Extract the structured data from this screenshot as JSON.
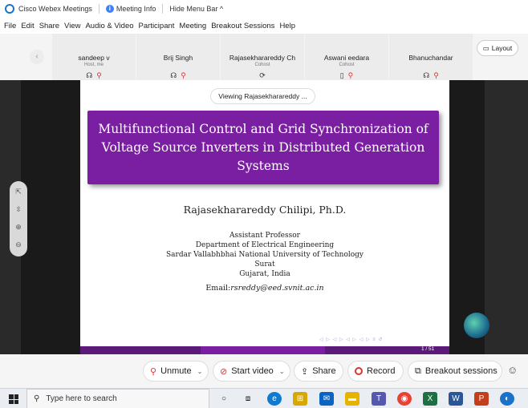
{
  "titlebar": {
    "app_title": "Cisco Webex Meetings",
    "meeting_info": "Meeting Info",
    "hide_menu": "Hide Menu Bar ^"
  },
  "menu": [
    "File",
    "Edit",
    "Share",
    "View",
    "Audio & Video",
    "Participant",
    "Meeting",
    "Breakout Sessions",
    "Help"
  ],
  "participants": [
    {
      "name": "sandeep v",
      "role": "Host, me"
    },
    {
      "name": "Brij Singh",
      "role": ""
    },
    {
      "name": "Rajasekharareddy Ch",
      "role": "Cohost"
    },
    {
      "name": "Aswani eedara",
      "role": "Cohost"
    },
    {
      "name": "Bhanuchandar",
      "role": ""
    }
  ],
  "layout_label": "Layout",
  "viewing_label": "Viewing Rajasekharareddy ...",
  "slide": {
    "title_lines": [
      "Multifunctional Control and Grid Synchronization of",
      "Voltage Source Inverters in Distributed Generation",
      "Systems"
    ],
    "author": "Rajasekharareddy Chilipi, Ph.D.",
    "affiliation": [
      "Assistant Professor",
      "Department of Electrical Engineering",
      "Sardar Vallabhbhai National University of Technology",
      "Surat",
      "Gujarat, India"
    ],
    "email_label": "Email:",
    "email": "rsreddy@eed.svnit.ac.in",
    "page": "1 / 51"
  },
  "controls": {
    "mute": "Unmute",
    "video": "Start video",
    "share": "Share",
    "record": "Record",
    "breakout": "Breakout sessions"
  },
  "taskbar": {
    "search_placeholder": "Type here to search"
  },
  "colors": {
    "slide_title_bg": "#7b1fa2",
    "mute_red": "#dd3333",
    "webex_blue": "#1a73c8"
  }
}
